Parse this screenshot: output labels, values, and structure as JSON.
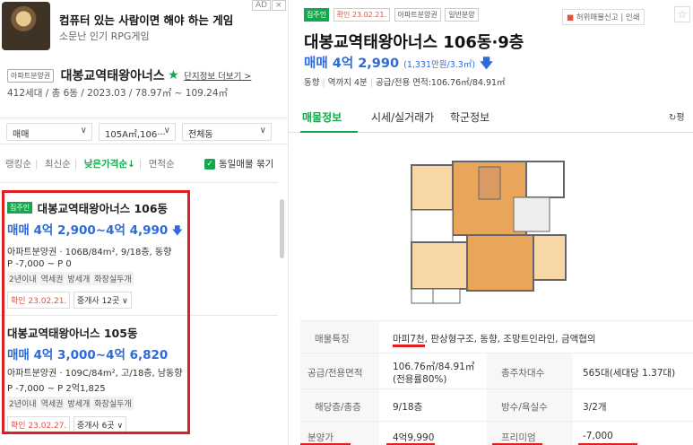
{
  "ad": {
    "title": "컴퓨터 있는 사람이면 해야 하는 게임",
    "subtitle": "소문난 인기 RPG게임",
    "badge": "AD",
    "close": "×"
  },
  "complex": {
    "type_tag": "아파트분양권",
    "name": "대봉교역태왕아너스",
    "star": "★",
    "link": "단지정보 더보기 >",
    "info": "412세대 / 총 6동 / 2023.03 / 78.97㎡ ~ 109.24㎡"
  },
  "filters": {
    "trade": "매매",
    "area": "105A㎡,106···",
    "dong": "전체동"
  },
  "sorts": {
    "items": [
      "랭킹순",
      "최신순",
      "낮은가격순↓",
      "면적순"
    ],
    "checkbox_label": "동일매물 묶기"
  },
  "listings": [
    {
      "tag": "집주인",
      "title": "대봉교역태왕아너스 106동",
      "price": "매매 4억 2,900~4억 4,990",
      "desc": "아파트분양권 · 106B/84m², 9/18층, 동향",
      "p": "P -7,000 ~ P 0",
      "chips": [
        "2년이내",
        "역세권",
        "방세개",
        "화장실두개"
      ],
      "confirm": "확인 23.02.21.",
      "agent": "중개사 12곳 ∨"
    },
    {
      "tag": "",
      "title": "대봉교역태왕아너스 105동",
      "price": "매매 4억 3,000~4억 6,820",
      "desc": "아파트분양권 · 109C/84m², 고/18층, 남동향",
      "p": "P -7,000 ~ P 2억1,825",
      "chips": [
        "2년이내",
        "역세권",
        "방세개",
        "화장실두개"
      ],
      "confirm": "확인 23.02.27.",
      "agent": "중개사 6곳 ∨"
    }
  ],
  "detail": {
    "tags": [
      "집주인",
      "확인 23.02.21.",
      "아파트분양권",
      "일반분양"
    ],
    "tools": "허위매물신고 | 인쇄",
    "title": "대봉교역태왕아너스 106동·9층",
    "price": "매매 4억 2,990",
    "price_small": "(1,331만원/3.3㎡)",
    "info": [
      "동향",
      "역까지 4분",
      "공급/전용 면적:106.76㎡/84.91㎡"
    ],
    "tabs": [
      "매물정보",
      "시세/실거래가",
      "학군정보"
    ],
    "refresh": "평",
    "rows": [
      {
        "label": "매물특징",
        "value": "마피7천, 판상형구조, 동향, 조망트인라인, 금액협의"
      },
      {
        "label": "공급/전용면적",
        "value": "106.76㎡/84.91㎡(전용률80%)",
        "label2": "총주차대수",
        "value2": "565대(세대당 1.37대)"
      },
      {
        "label": "해당층/총층",
        "value": "9/18층",
        "label2": "방수/욕실수",
        "value2": "3/2개"
      },
      {
        "label": "분양가",
        "value": "4억9,990",
        "label2": "프리미엄",
        "value2": "-7,000"
      }
    ]
  },
  "colors": {
    "brand_green": "#12a84b",
    "price_blue": "#2f6bd8",
    "highlight_red": "#e02020"
  }
}
